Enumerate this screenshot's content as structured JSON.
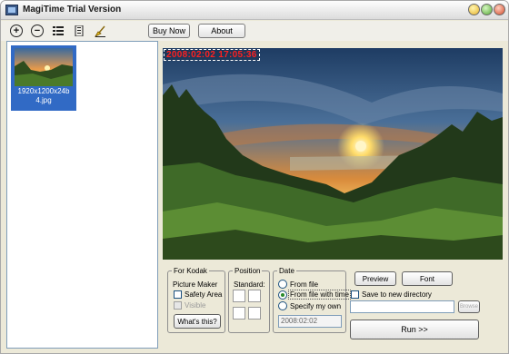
{
  "window": {
    "title": "MagiTime Trial Version"
  },
  "toolbar": {
    "icons": [
      "add-icon",
      "remove-icon",
      "list-view-icon",
      "details-view-icon",
      "clean-brush-icon"
    ],
    "buy_now": "Buy Now",
    "about": "About"
  },
  "thumbnails": [
    {
      "caption": "1920x1200x24b 4.jpg"
    }
  ],
  "preview": {
    "stamp_text": "2008:02:02 17:05:36",
    "stamp_color": "#ff2020"
  },
  "kodak": {
    "legend": "For Kodak",
    "subtitle": "Picture Maker",
    "safety_area": "Safety Area",
    "visible": "Visible",
    "whats_this": "What's this?"
  },
  "position": {
    "legend": "Position",
    "standard": "Standard:"
  },
  "date": {
    "legend": "Date",
    "options": [
      "From file",
      "From file with time",
      "Specify my own"
    ],
    "selected": "From file with time",
    "date_value": "2008:02:02"
  },
  "actions": {
    "preview": "Preview",
    "font": "Font",
    "save_new_dir": "Save to new directory",
    "browse": "Browse",
    "run": "Run >>"
  }
}
